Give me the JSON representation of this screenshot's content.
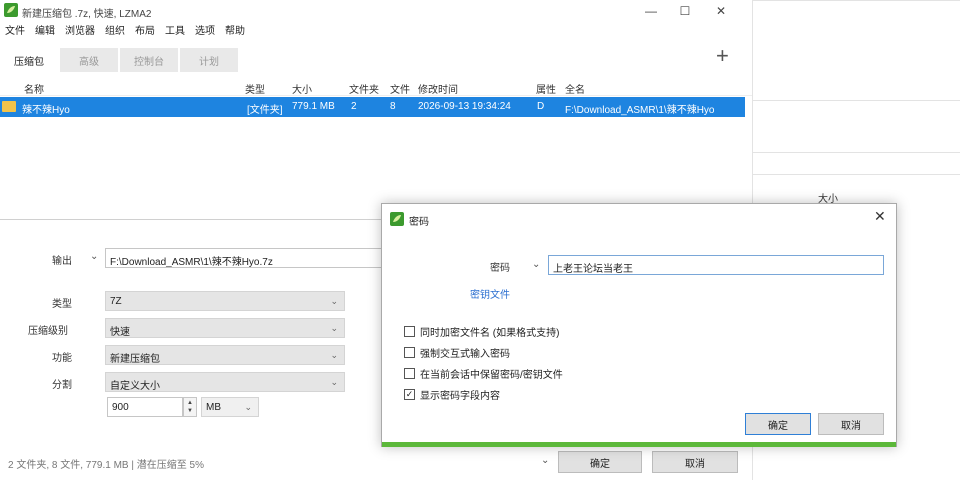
{
  "window": {
    "title": "新建压缩包 .7z, 快速, LZMA2",
    "controls": {
      "minimize": "—",
      "maximize": "☐",
      "close": "✕"
    }
  },
  "menu": [
    "文件",
    "编辑",
    "浏览器",
    "组织",
    "布局",
    "工具",
    "选项",
    "帮助"
  ],
  "tabs": [
    {
      "label": "压缩包",
      "active": true
    },
    {
      "label": "高级",
      "active": false
    },
    {
      "label": "控制台",
      "active": false
    },
    {
      "label": "计划",
      "active": false
    }
  ],
  "add_symbol": "+",
  "filelist": {
    "headers": {
      "name": "名称",
      "type": "类型",
      "size": "大小",
      "folders": "文件夹",
      "files": "文件",
      "modified": "修改时间",
      "attr": "属性",
      "fullname": "全名"
    },
    "row": {
      "name": "辣不辣Hyo",
      "type": "[文件夹]",
      "size": "779.1 MB",
      "folders": "2",
      "files": "8",
      "modified": "2026-09-13 19:34:24",
      "attr": "D",
      "fullname": "F:\\Download_ASMR\\1\\辣不辣Hyo"
    }
  },
  "background_window": {
    "size_header": "大小"
  },
  "settings": {
    "output_label": "输出",
    "output_value": "F:\\Download_ASMR\\1\\辣不辣Hyo.7z",
    "type_label": "类型",
    "type_value": "7Z",
    "level_label": "压缩级别",
    "level_value": "快速",
    "function_label": "功能",
    "function_value": "新建压缩包",
    "split_label": "分割",
    "split_value": "自定义大小",
    "split_size": "900",
    "split_unit": "MB"
  },
  "status": "2 文件夹, 8 文件, 779.1 MB | 潜在压缩至 5%",
  "buttons": {
    "ok": "确定",
    "cancel": "取消"
  },
  "password_dialog": {
    "title": "密码",
    "password_label": "密码",
    "password_value": "上老王论坛当老王",
    "keyfile_link": "密钥文件",
    "options": [
      {
        "label": "同时加密文件名 (如果格式支持)",
        "checked": false
      },
      {
        "label": "强制交互式输入密码",
        "checked": false
      },
      {
        "label": "在当前会话中保留密码/密钥文件",
        "checked": false
      },
      {
        "label": "显示密码字段内容",
        "checked": true
      }
    ],
    "ok": "确定",
    "cancel": "取消",
    "accent_color": "#5cb83a"
  },
  "colors": {
    "selection": "#1e84e0",
    "folder": "#f2c34a"
  }
}
